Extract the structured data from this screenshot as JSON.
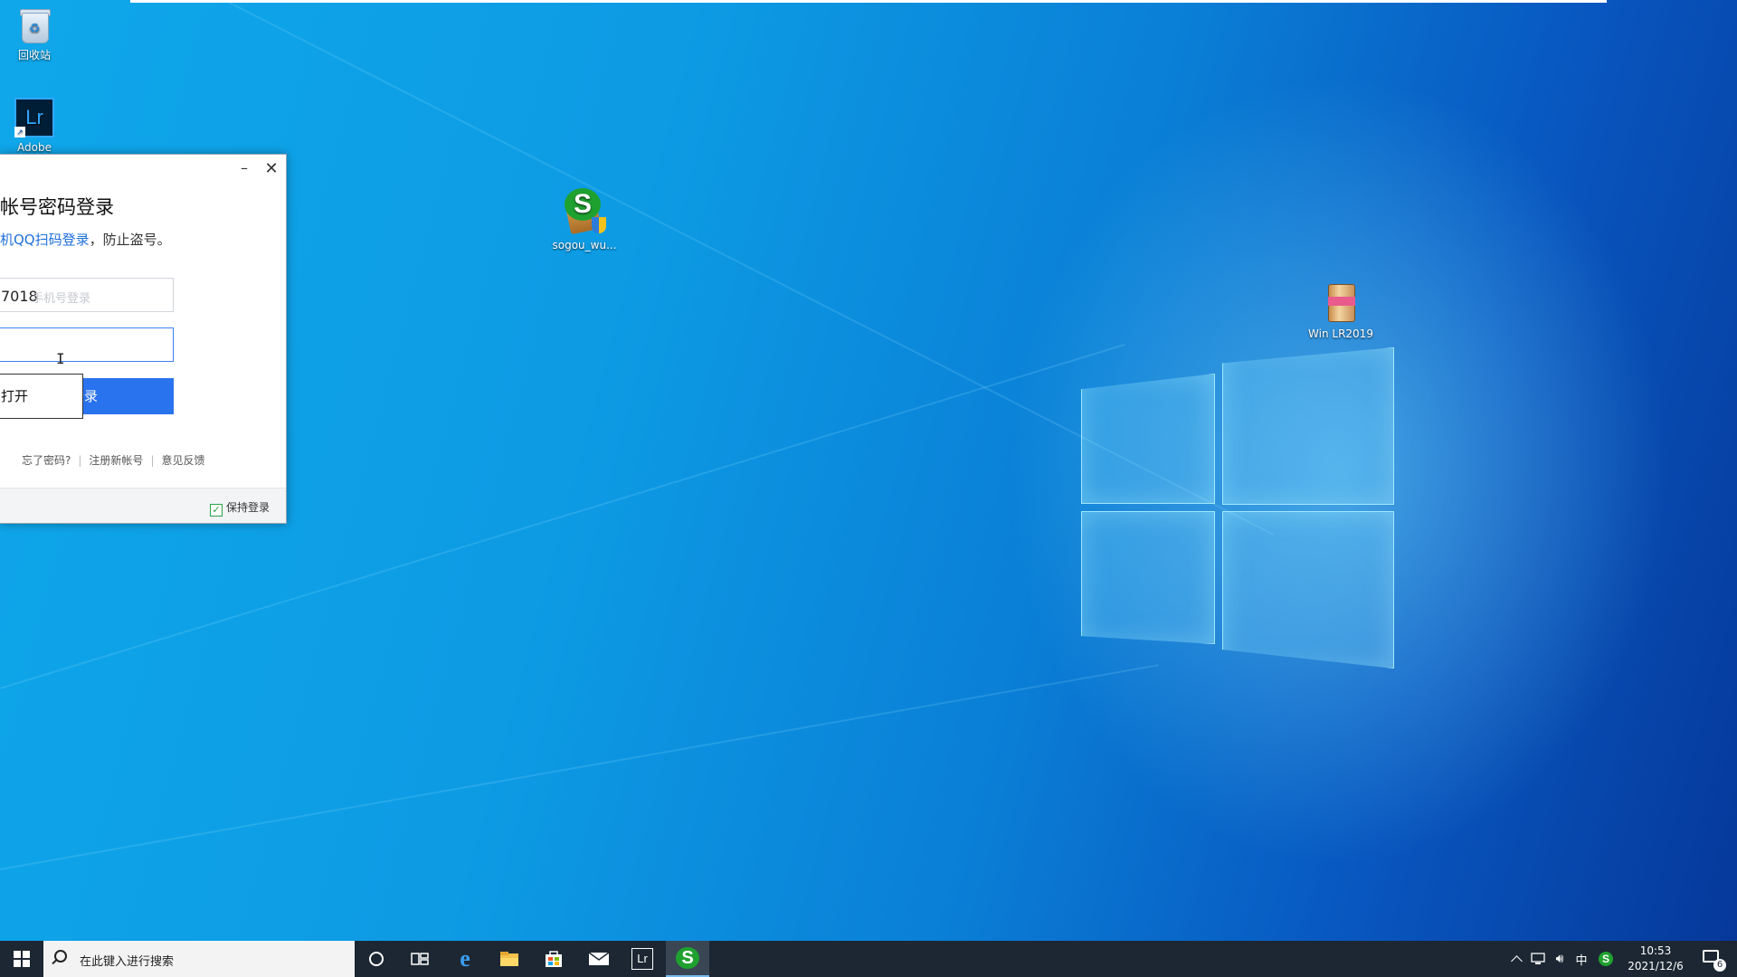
{
  "desktop": {
    "icons": {
      "recycle_bin": "回收站",
      "lightroom": "Adobe",
      "sogou": "sogou_wu...",
      "win_lr": "Win LR2019"
    }
  },
  "login_window": {
    "title": "帐号密码登录",
    "sub_link": "机QQ扫码登录",
    "sub_rest": "，防止盗号。",
    "account_value": "7018",
    "account_placeholder": "手机号登录",
    "login_button": "登录",
    "popup_text": "打开",
    "forgot_password": "忘了密码?",
    "register": "注册新帐号",
    "feedback": "意见反馈",
    "keep_login": "保持登录",
    "keep_login_checked": true
  },
  "taskbar": {
    "search_placeholder": "在此键入进行搜索",
    "ime_indicator": "中",
    "clock_time": "10:53",
    "clock_date": "2021/12/6",
    "notification_count": "6"
  },
  "colors": {
    "accent": "#2a73ee",
    "taskbar": "#1c2733",
    "link": "#1e6fd9"
  }
}
